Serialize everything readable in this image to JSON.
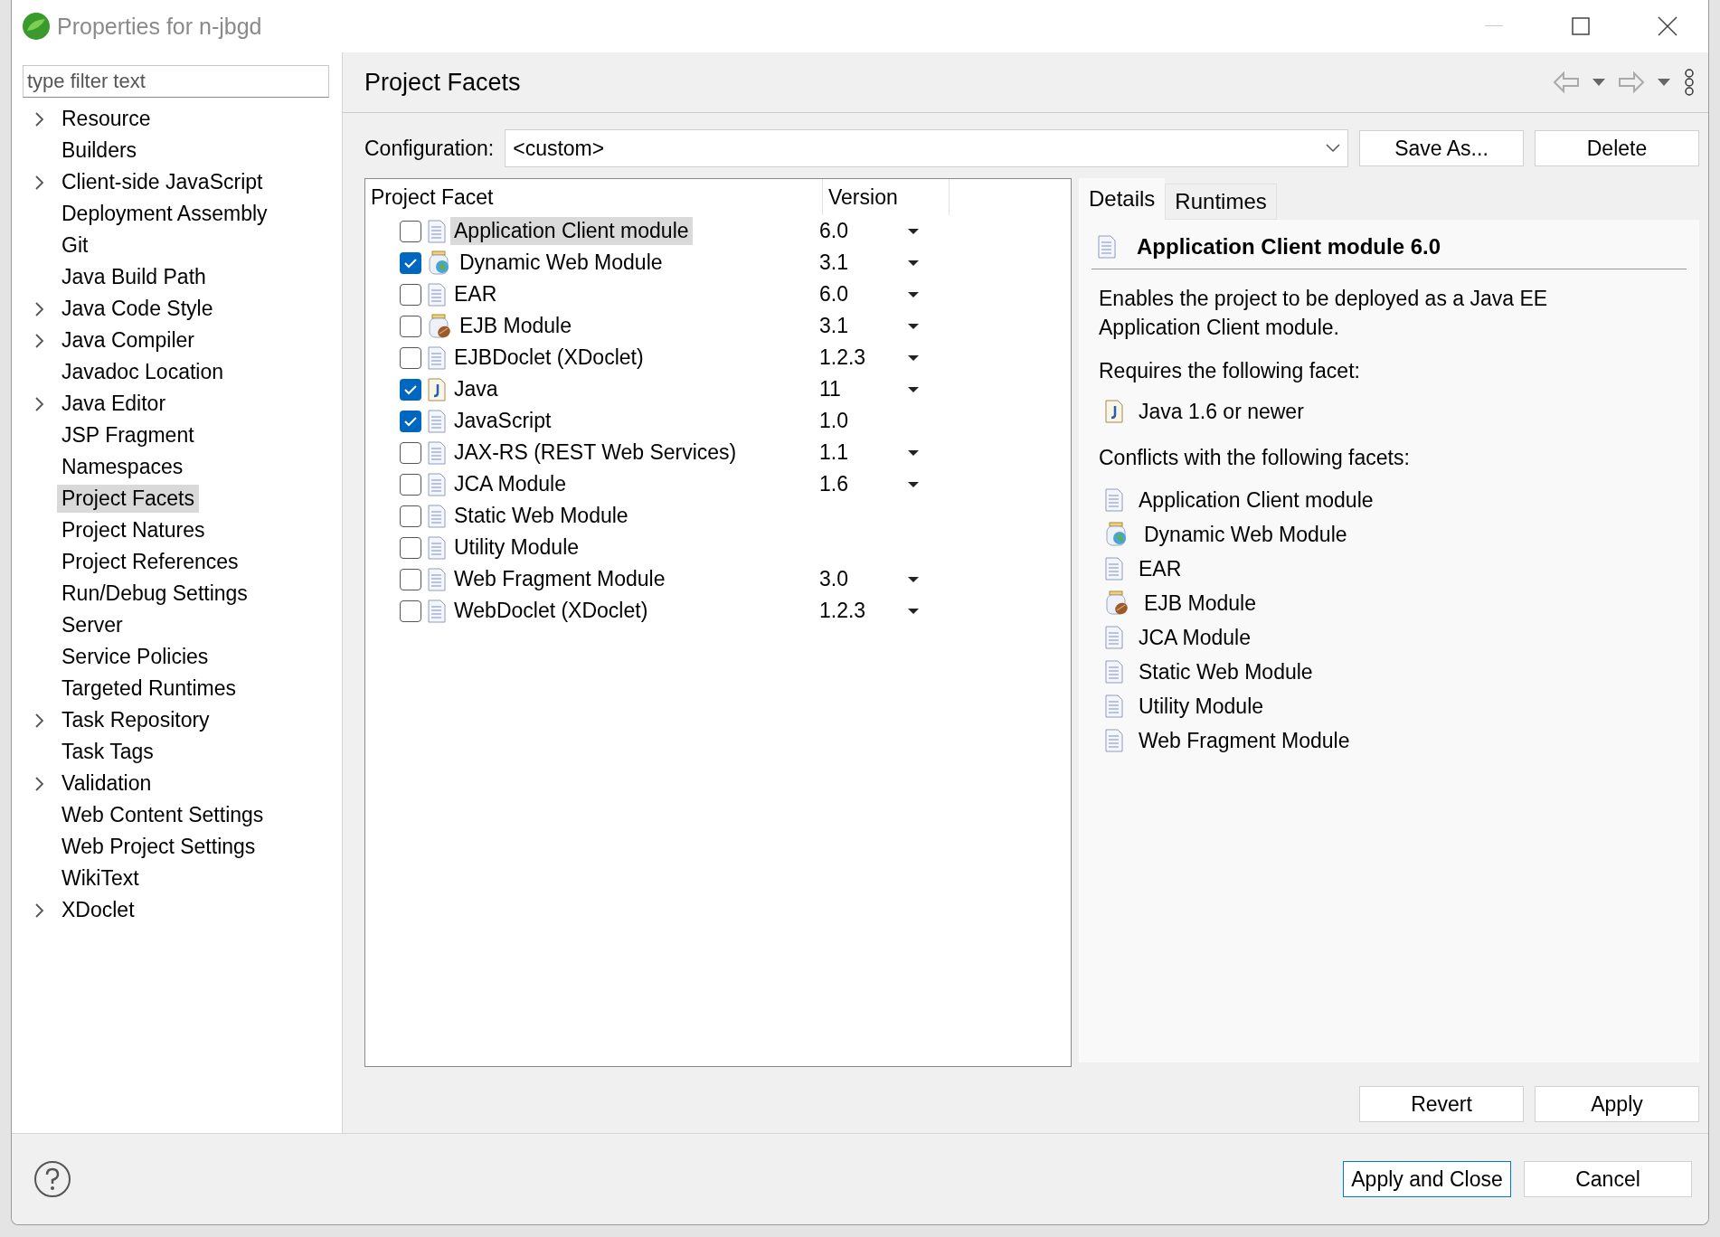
{
  "window": {
    "title": "Properties for n-jbgd"
  },
  "filter": {
    "placeholder": "type filter text"
  },
  "tree": [
    {
      "label": "Resource",
      "expandable": true,
      "selected": false
    },
    {
      "label": "Builders",
      "expandable": false,
      "selected": false
    },
    {
      "label": "Client-side JavaScript",
      "expandable": true,
      "selected": false
    },
    {
      "label": "Deployment Assembly",
      "expandable": false,
      "selected": false
    },
    {
      "label": "Git",
      "expandable": false,
      "selected": false
    },
    {
      "label": "Java Build Path",
      "expandable": false,
      "selected": false
    },
    {
      "label": "Java Code Style",
      "expandable": true,
      "selected": false
    },
    {
      "label": "Java Compiler",
      "expandable": true,
      "selected": false
    },
    {
      "label": "Javadoc Location",
      "expandable": false,
      "selected": false
    },
    {
      "label": "Java Editor",
      "expandable": true,
      "selected": false
    },
    {
      "label": "JSP Fragment",
      "expandable": false,
      "selected": false
    },
    {
      "label": "Namespaces",
      "expandable": false,
      "selected": false
    },
    {
      "label": "Project Facets",
      "expandable": false,
      "selected": true
    },
    {
      "label": "Project Natures",
      "expandable": false,
      "selected": false
    },
    {
      "label": "Project References",
      "expandable": false,
      "selected": false
    },
    {
      "label": "Run/Debug Settings",
      "expandable": false,
      "selected": false
    },
    {
      "label": "Server",
      "expandable": false,
      "selected": false
    },
    {
      "label": "Service Policies",
      "expandable": false,
      "selected": false
    },
    {
      "label": "Targeted Runtimes",
      "expandable": false,
      "selected": false
    },
    {
      "label": "Task Repository",
      "expandable": true,
      "selected": false
    },
    {
      "label": "Task Tags",
      "expandable": false,
      "selected": false
    },
    {
      "label": "Validation",
      "expandable": true,
      "selected": false
    },
    {
      "label": "Web Content Settings",
      "expandable": false,
      "selected": false
    },
    {
      "label": "Web Project Settings",
      "expandable": false,
      "selected": false
    },
    {
      "label": "WikiText",
      "expandable": false,
      "selected": false
    },
    {
      "label": "XDoclet",
      "expandable": true,
      "selected": false
    }
  ],
  "page": {
    "title": "Project Facets"
  },
  "configuration": {
    "label": "Configuration:",
    "value": "<custom>",
    "buttons": [
      "Save As...",
      "Delete"
    ]
  },
  "table": {
    "columns": [
      "Project Facet",
      "Version"
    ],
    "rows": [
      {
        "name": "Application Client module",
        "kind": "document",
        "checked": false,
        "selected": true,
        "version": "6.0",
        "dropdown": true
      },
      {
        "name": "Dynamic Web Module",
        "kind": "web",
        "checked": true,
        "selected": false,
        "version": "3.1",
        "dropdown": true
      },
      {
        "name": "EAR",
        "kind": "document",
        "checked": false,
        "selected": false,
        "version": "6.0",
        "dropdown": true
      },
      {
        "name": "EJB Module",
        "kind": "ejb",
        "checked": false,
        "selected": false,
        "version": "3.1",
        "dropdown": true
      },
      {
        "name": "EJBDoclet (XDoclet)",
        "kind": "document",
        "checked": false,
        "selected": false,
        "version": "1.2.3",
        "dropdown": true
      },
      {
        "name": "Java",
        "kind": "java",
        "checked": true,
        "selected": false,
        "version": "11",
        "dropdown": true
      },
      {
        "name": "JavaScript",
        "kind": "document",
        "checked": true,
        "selected": false,
        "version": "1.0",
        "dropdown": false
      },
      {
        "name": "JAX-RS (REST Web Services)",
        "kind": "document",
        "checked": false,
        "selected": false,
        "version": "1.1",
        "dropdown": true
      },
      {
        "name": "JCA Module",
        "kind": "document",
        "checked": false,
        "selected": false,
        "version": "1.6",
        "dropdown": true
      },
      {
        "name": "Static Web Module",
        "kind": "document",
        "checked": false,
        "selected": false
      },
      {
        "name": "Utility Module",
        "kind": "document",
        "checked": false,
        "selected": false
      },
      {
        "name": "Web Fragment Module",
        "kind": "document",
        "checked": false,
        "selected": false,
        "version": "3.0",
        "dropdown": true
      },
      {
        "name": "WebDoclet (XDoclet)",
        "kind": "document",
        "checked": false,
        "selected": false,
        "version": "1.2.3",
        "dropdown": true
      }
    ]
  },
  "details": {
    "tabs": [
      {
        "label": "Details",
        "selected": true
      },
      {
        "label": "Runtimes",
        "selected": false
      }
    ],
    "heading": {
      "text": "Application Client module 6.0",
      "kind": "document"
    },
    "description": "Enables the project to be deployed as a Java EE Application Client module.",
    "requires_label": "Requires the following facet:",
    "requires": [
      {
        "text": "Java 1.6 or newer",
        "kind": "java"
      }
    ],
    "conflicts_label": "Conflicts with the following facets:",
    "conflicts": [
      {
        "text": "Application Client module",
        "kind": "document"
      },
      {
        "text": "Dynamic Web Module",
        "kind": "web"
      },
      {
        "text": "EAR",
        "kind": "document"
      },
      {
        "text": "EJB Module",
        "kind": "ejb"
      },
      {
        "text": "JCA Module",
        "kind": "document"
      },
      {
        "text": "Static Web Module",
        "kind": "document"
      },
      {
        "text": "Utility Module",
        "kind": "document"
      },
      {
        "text": "Web Fragment Module",
        "kind": "document"
      }
    ]
  },
  "page_buttons": [
    "Revert",
    "Apply"
  ],
  "dialog_buttons": [
    {
      "label": "Apply and Close",
      "default": true
    },
    {
      "label": "Cancel",
      "default": false
    }
  ]
}
